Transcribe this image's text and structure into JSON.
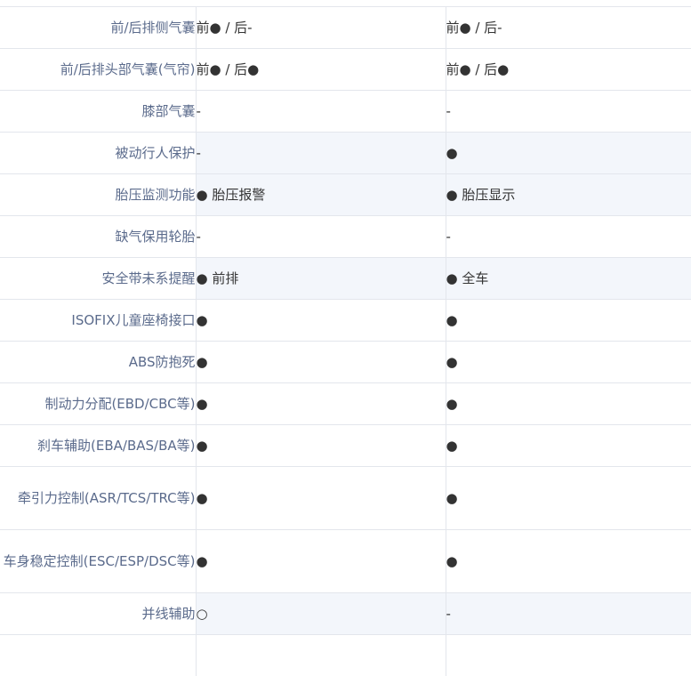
{
  "rows": [
    {
      "label": "前/后排侧气囊",
      "a": "前● / 后-",
      "b": "前● / 后-"
    },
    {
      "label": "前/后排头部气囊(气帘)",
      "a": "前● / 后●",
      "b": "前● / 后●"
    },
    {
      "label": "膝部气囊",
      "a": "-",
      "b": "-"
    },
    {
      "label": "被动行人保护",
      "a": "-",
      "b": "●"
    },
    {
      "label": "胎压监测功能",
      "a": "● 胎压报警",
      "b": "● 胎压显示"
    },
    {
      "label": "缺气保用轮胎",
      "a": "-",
      "b": "-"
    },
    {
      "label": "安全带未系提醒",
      "a": "● 前排",
      "b": "● 全车"
    },
    {
      "label": "ISOFIX儿童座椅接口",
      "a": "●",
      "b": "●"
    },
    {
      "label": "ABS防抱死",
      "a": "●",
      "b": "●"
    },
    {
      "label": "制动力分配(EBD/CBC等)",
      "a": "●",
      "b": "●"
    },
    {
      "label": "刹车辅助(EBA/BAS/BA等)",
      "a": "●",
      "b": "●"
    },
    {
      "label": "牵引力控制(ASR/TCS/TRC等)",
      "a": "●",
      "b": "●"
    },
    {
      "label": "车身稳定控制(ESC/ESP/DSC等)",
      "a": "●",
      "b": "●"
    },
    {
      "label": "并线辅助",
      "a": "○",
      "b": "-"
    }
  ]
}
